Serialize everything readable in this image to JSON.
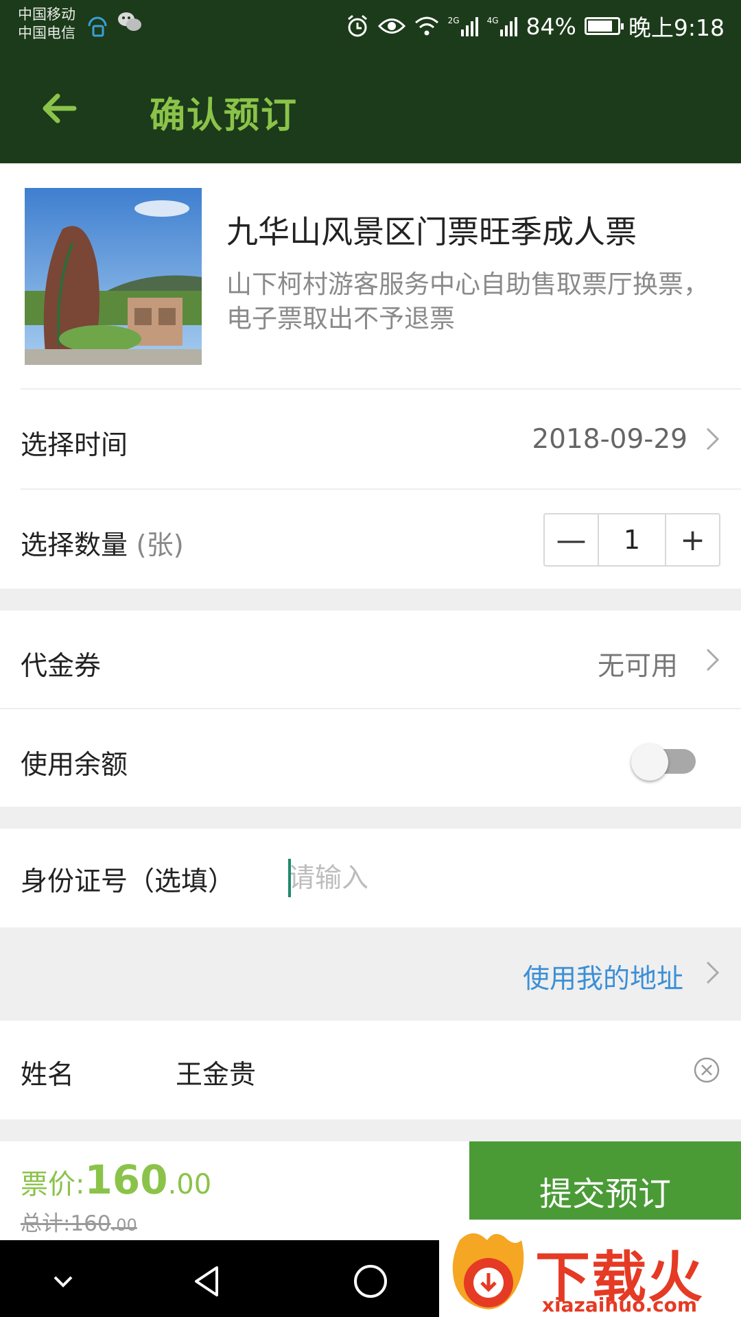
{
  "status_bar": {
    "carrier_1": "中国移动",
    "carrier_2": "中国电信",
    "signal_2g": "2G",
    "signal_4g": "4G",
    "battery": "84%",
    "battery_level": 0.84,
    "time": "晚上9:18"
  },
  "header": {
    "title": "确认预订",
    "back_icon": "arrow-left-icon"
  },
  "product": {
    "title": "九华山风景区门票旺季成人票",
    "description": "山下柯村游客服务中心自助售取票厅换票，电子票取出不予退票"
  },
  "date_row": {
    "label": "选择时间",
    "value": "2018-09-29"
  },
  "quantity_row": {
    "label": "选择数量",
    "unit": "(张)",
    "minus": "—",
    "value": "1",
    "plus": "+"
  },
  "voucher_row": {
    "label": "代金券",
    "value": "无可用"
  },
  "balance_row": {
    "label": "使用余额",
    "enabled": false
  },
  "id_row": {
    "label": "身份证号（选填）",
    "placeholder": "请输入"
  },
  "address": {
    "link": "使用我的地址"
  },
  "name_row": {
    "label": "姓名",
    "value": "王金贵"
  },
  "footer": {
    "price_label": "票价:",
    "price_int": "160",
    "price_dec": ".00",
    "total_label": "总计:",
    "total_int": "160",
    "total_dec": ".00",
    "submit": "提交预订"
  },
  "watermark": {
    "text": "下载火",
    "url": "xiazaihuo.com"
  },
  "colors": {
    "header_bg": "#1c3b1a",
    "accent_green": "#8bc34a",
    "submit_bg": "#4a9b36",
    "link_blue": "#3b8fd6"
  }
}
